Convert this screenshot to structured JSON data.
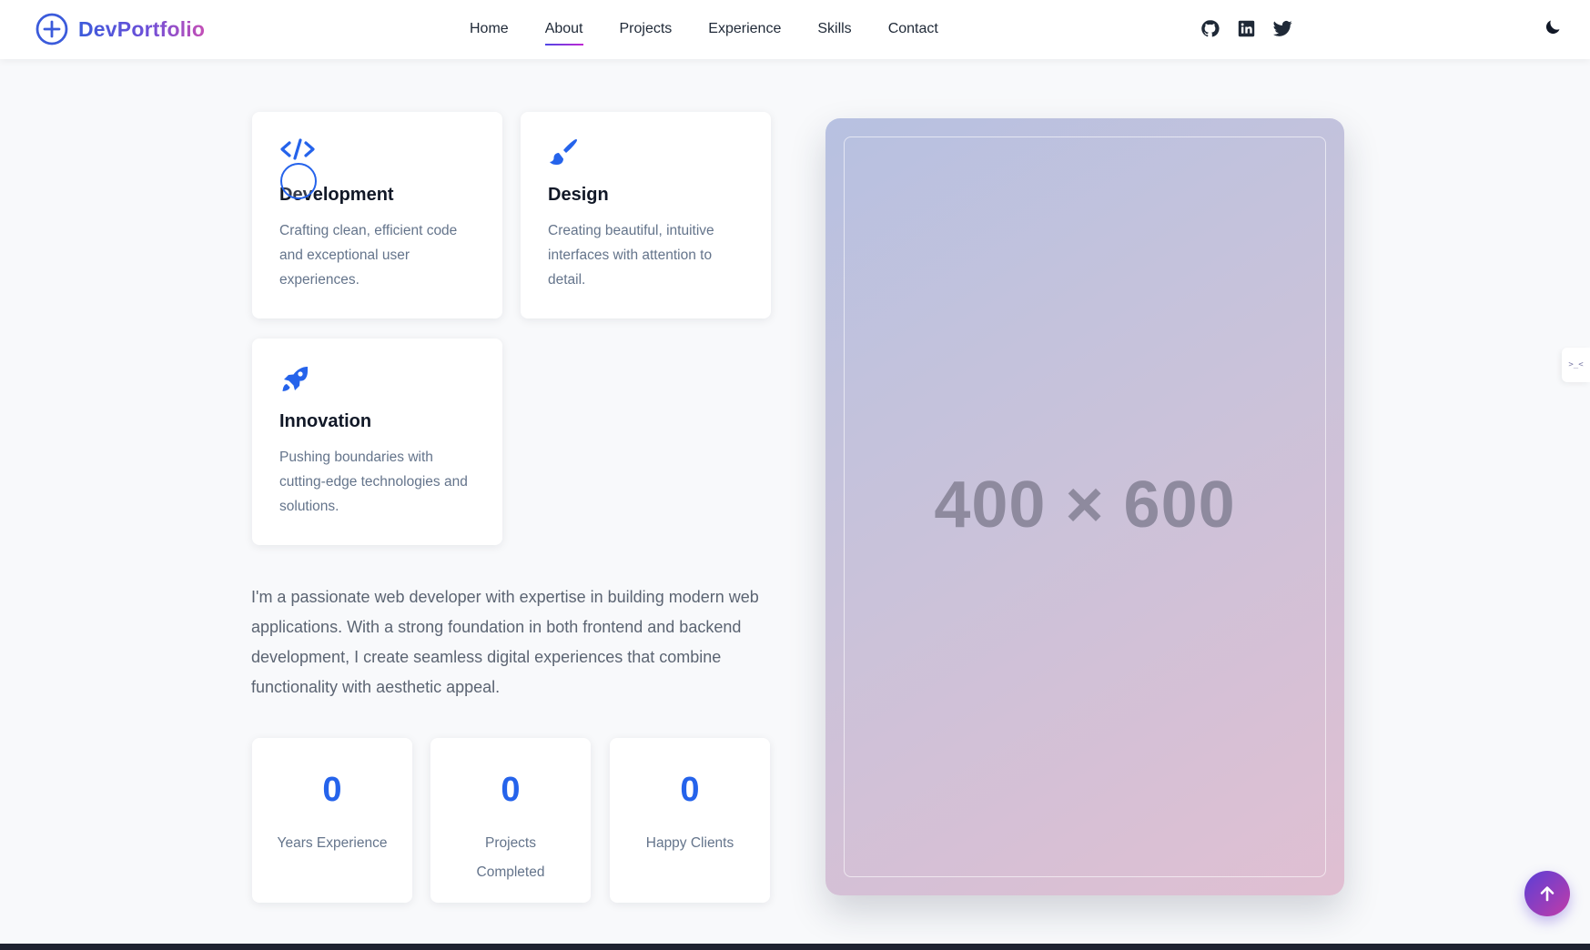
{
  "header": {
    "brand": "DevPortfolio",
    "nav": [
      "Home",
      "About",
      "Projects",
      "Experience",
      "Skills",
      "Contact"
    ],
    "active_nav": "About",
    "social_icons": [
      "github-icon",
      "linkedin-icon",
      "twitter-icon"
    ],
    "theme_icon": "moon-icon"
  },
  "features": [
    {
      "icon": "code-icon",
      "title": "Development",
      "desc": "Crafting clean, efficient code and exceptional user experiences."
    },
    {
      "icon": "paintbrush-icon",
      "title": "Design",
      "desc": "Creating beautiful, intuitive interfaces with attention to detail."
    },
    {
      "icon": "rocket-icon",
      "title": "Innovation",
      "desc": "Pushing boundaries with cutting-edge technologies and solutions."
    }
  ],
  "about": {
    "paragraph": "I'm a passionate web developer with expertise in building modern web applications. With a strong foundation in both frontend and backend development, I create seamless digital experiences that combine functionality with aesthetic appeal."
  },
  "stats": [
    {
      "value": "0",
      "label": "Years Experience"
    },
    {
      "value": "0",
      "label": "Projects Completed"
    },
    {
      "value": "0",
      "label": "Happy Clients"
    }
  ],
  "image_placeholder": {
    "label": "400 × 600"
  },
  "side_tab": {
    "label": ">_<"
  },
  "colors": {
    "accent": "#2563eb",
    "gradient_start": "#4f46e5",
    "gradient_end": "#c026d3"
  }
}
